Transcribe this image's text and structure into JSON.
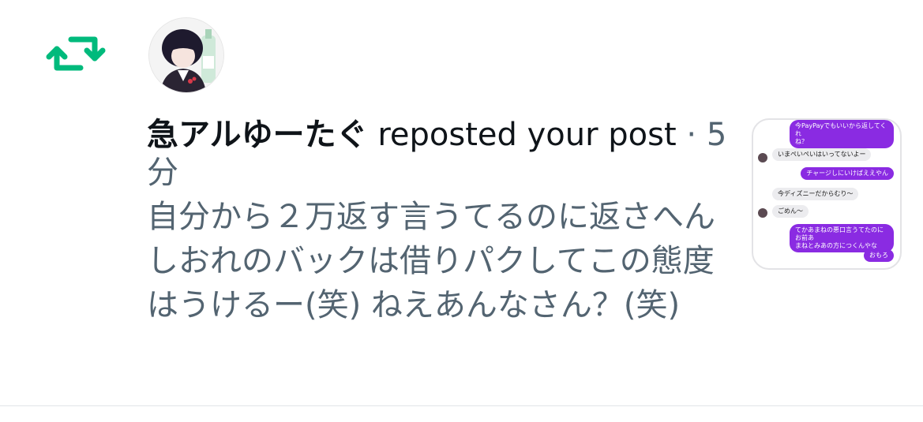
{
  "notification": {
    "icon": "repost-icon",
    "accent_color": "#00ba7c",
    "user_name": "急アルゆーたぐ",
    "action_text": " reposted your post",
    "separator": " · ",
    "time": "5分",
    "post_text": "自分から２万返す言うてるのに返さへんしおれのバックは借りパクしてこの態度はうけるー(笑) ねえあんなさん？(笑)"
  },
  "thumbnail": {
    "messages": [
      {
        "from": "me",
        "text": "今PayPayでもいいから返してくれ\nね？"
      },
      {
        "from": "them",
        "text": "いまぺいぺいはいってないよー"
      },
      {
        "from": "me",
        "text": "チャージしにいけばええやん"
      },
      {
        "from": "them",
        "text": "今ディズニーだからむり〜"
      },
      {
        "from": "them",
        "text": "ごめん〜"
      },
      {
        "from": "me",
        "text": "てかあまねの悪口言うてたのにお前あ\nまねとみあの方につくんやな"
      },
      {
        "from": "me",
        "text": "おもろ"
      }
    ],
    "me_color": "#8a2be2",
    "them_color": "#ececef"
  }
}
